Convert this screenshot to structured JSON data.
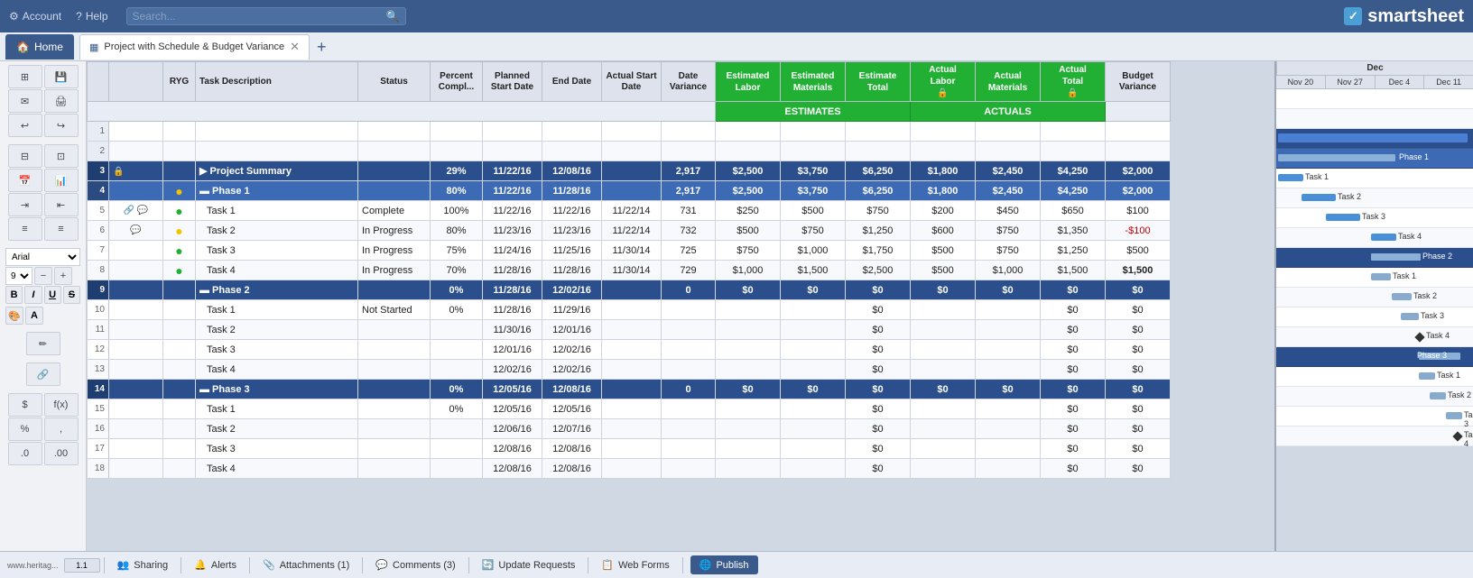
{
  "topnav": {
    "account": "Account",
    "help": "Help",
    "search_placeholder": "Search...",
    "logo_check": "✓",
    "logo_text_smart": "smart",
    "logo_text_sheet": "sheet"
  },
  "tabs": {
    "home_label": "Home",
    "project_label": "Project with Schedule & Budget Variance",
    "add_label": "+"
  },
  "columns": {
    "row_num": "#",
    "icons": "",
    "ryg": "RYG",
    "task_desc": "Task Description",
    "status": "Status",
    "pct_complete": "Percent Compl...",
    "planned_start": "Planned Start Date",
    "end_date": "End Date",
    "actual_start": "Actual Start Date",
    "date_variance": "Date Variance",
    "est_labor": "Estimated Labor",
    "est_materials": "Estimated Materials",
    "est_total": "Estimate Total",
    "actual_labor": "Actual Labor",
    "actual_materials": "Actual Materials",
    "actual_total": "Actual Total",
    "budget_variance": "Budget Variance",
    "estimates_group": "ESTIMATES",
    "actuals_group": "ACTUALS"
  },
  "gantt": {
    "headers": [
      "Nov 20",
      "Nov 27",
      "Dec 4",
      "Dec 11"
    ],
    "month": "Dec"
  },
  "rows": [
    {
      "num": "1",
      "type": "empty"
    },
    {
      "num": "2",
      "type": "empty"
    },
    {
      "num": "3",
      "type": "project_summary",
      "task": "Project Summary",
      "pct": "29%",
      "planned_start": "11/22/16",
      "end_date": "12/08/16",
      "date_variance": "2,917",
      "est_labor": "$2,500",
      "est_materials": "$3,750",
      "est_total": "$6,250",
      "actual_labor": "$1,800",
      "actual_materials": "$2,450",
      "actual_total": "$4,250",
      "budget_variance": "$2,000"
    },
    {
      "num": "4",
      "type": "phase",
      "task": "Phase 1",
      "pct": "80%",
      "planned_start": "11/22/16",
      "end_date": "11/28/16",
      "date_variance": "2,917",
      "est_labor": "$2,500",
      "est_materials": "$3,750",
      "est_total": "$6,250",
      "actual_labor": "$1,800",
      "actual_materials": "$2,450",
      "actual_total": "$4,250",
      "budget_variance": "$2,000",
      "ryg": "yellow"
    },
    {
      "num": "5",
      "type": "task",
      "task": "Task 1",
      "status": "Complete",
      "pct": "100%",
      "planned_start": "11/22/16",
      "end_date": "11/22/16",
      "actual_start": "11/22/14",
      "date_variance": "731",
      "est_labor": "$250",
      "est_materials": "$500",
      "est_total": "$750",
      "actual_labor": "$200",
      "actual_materials": "$450",
      "actual_total": "$650",
      "budget_variance": "$100",
      "ryg": "green",
      "icons": "link comment"
    },
    {
      "num": "6",
      "type": "task",
      "task": "Task 2",
      "status": "In Progress",
      "pct": "80%",
      "planned_start": "11/23/16",
      "end_date": "11/23/16",
      "actual_start": "11/22/14",
      "date_variance": "732",
      "est_labor": "$500",
      "est_materials": "$750",
      "est_total": "$1,250",
      "actual_labor": "$600",
      "actual_materials": "$750",
      "actual_total": "$1,350",
      "budget_variance": "-$100",
      "ryg": "yellow",
      "icons": "comment"
    },
    {
      "num": "7",
      "type": "task",
      "task": "Task 3",
      "status": "In Progress",
      "pct": "75%",
      "planned_start": "11/24/16",
      "end_date": "11/25/16",
      "actual_start": "11/30/14",
      "date_variance": "725",
      "est_labor": "$750",
      "est_materials": "$1,000",
      "est_total": "$1,750",
      "actual_labor": "$500",
      "actual_materials": "$750",
      "actual_total": "$1,250",
      "budget_variance": "$500",
      "ryg": "green"
    },
    {
      "num": "8",
      "type": "task",
      "task": "Task 4",
      "status": "In Progress",
      "pct": "70%",
      "planned_start": "11/28/16",
      "end_date": "11/28/16",
      "actual_start": "11/30/14",
      "date_variance": "729",
      "est_labor": "$1,000",
      "est_materials": "$1,500",
      "est_total": "$2,500",
      "actual_labor": "$500",
      "actual_materials": "$1,000",
      "actual_total": "$1,500",
      "budget_variance": "$1,500",
      "ryg": "green"
    },
    {
      "num": "9",
      "type": "phase2",
      "task": "Phase 2",
      "pct": "0%",
      "planned_start": "11/28/16",
      "end_date": "12/02/16",
      "date_variance": "0",
      "est_labor": "$0",
      "est_materials": "$0",
      "est_total": "$0",
      "actual_labor": "$0",
      "actual_materials": "$0",
      "actual_total": "$0",
      "budget_variance": "$0"
    },
    {
      "num": "10",
      "type": "task",
      "task": "Task 1",
      "status": "Not Started",
      "pct": "0%",
      "planned_start": "11/28/16",
      "end_date": "11/29/16",
      "est_total": "$0",
      "actual_total": "$0",
      "budget_variance": "$0"
    },
    {
      "num": "11",
      "type": "task",
      "task": "Task 2",
      "planned_start": "11/30/16",
      "end_date": "12/01/16",
      "est_total": "$0",
      "actual_total": "$0",
      "budget_variance": "$0"
    },
    {
      "num": "12",
      "type": "task",
      "task": "Task 3",
      "planned_start": "12/01/16",
      "end_date": "12/02/16",
      "est_total": "$0",
      "actual_total": "$0",
      "budget_variance": "$0"
    },
    {
      "num": "13",
      "type": "task",
      "task": "Task 4",
      "planned_start": "12/02/16",
      "end_date": "12/02/16",
      "est_total": "$0",
      "actual_total": "$0",
      "budget_variance": "$0"
    },
    {
      "num": "14",
      "type": "phase3",
      "task": "Phase 3",
      "pct": "0%",
      "planned_start": "12/05/16",
      "end_date": "12/08/16",
      "date_variance": "0",
      "est_labor": "$0",
      "est_materials": "$0",
      "est_total": "$0",
      "actual_labor": "$0",
      "actual_materials": "$0",
      "actual_total": "$0",
      "budget_variance": "$0"
    },
    {
      "num": "15",
      "type": "task",
      "task": "Task 1",
      "pct": "0%",
      "planned_start": "12/05/16",
      "end_date": "12/05/16",
      "est_total": "$0",
      "actual_total": "$0",
      "budget_variance": "$0"
    },
    {
      "num": "16",
      "type": "task",
      "task": "Task 2",
      "planned_start": "12/06/16",
      "end_date": "12/07/16",
      "est_total": "$0",
      "actual_total": "$0",
      "budget_variance": "$0"
    },
    {
      "num": "17",
      "type": "task",
      "task": "Task 3",
      "planned_start": "12/08/16",
      "end_date": "12/08/16",
      "est_total": "$0",
      "actual_total": "$0",
      "budget_variance": "$0"
    },
    {
      "num": "18",
      "type": "task",
      "task": "Task 4",
      "planned_start": "12/08/16",
      "end_date": "12/08/16",
      "est_total": "$0",
      "actual_total": "$0",
      "budget_variance": "$0"
    }
  ],
  "bottom_tabs": [
    {
      "label": "Sharing",
      "icon": "👥"
    },
    {
      "label": "Alerts",
      "icon": "🔔"
    },
    {
      "label": "Attachments (1)",
      "icon": "📎"
    },
    {
      "label": "Comments (3)",
      "icon": "💬"
    },
    {
      "label": "Update Requests",
      "icon": "🔄"
    },
    {
      "label": "Web Forms",
      "icon": "📋"
    },
    {
      "label": "Publish",
      "icon": "🌐"
    }
  ]
}
